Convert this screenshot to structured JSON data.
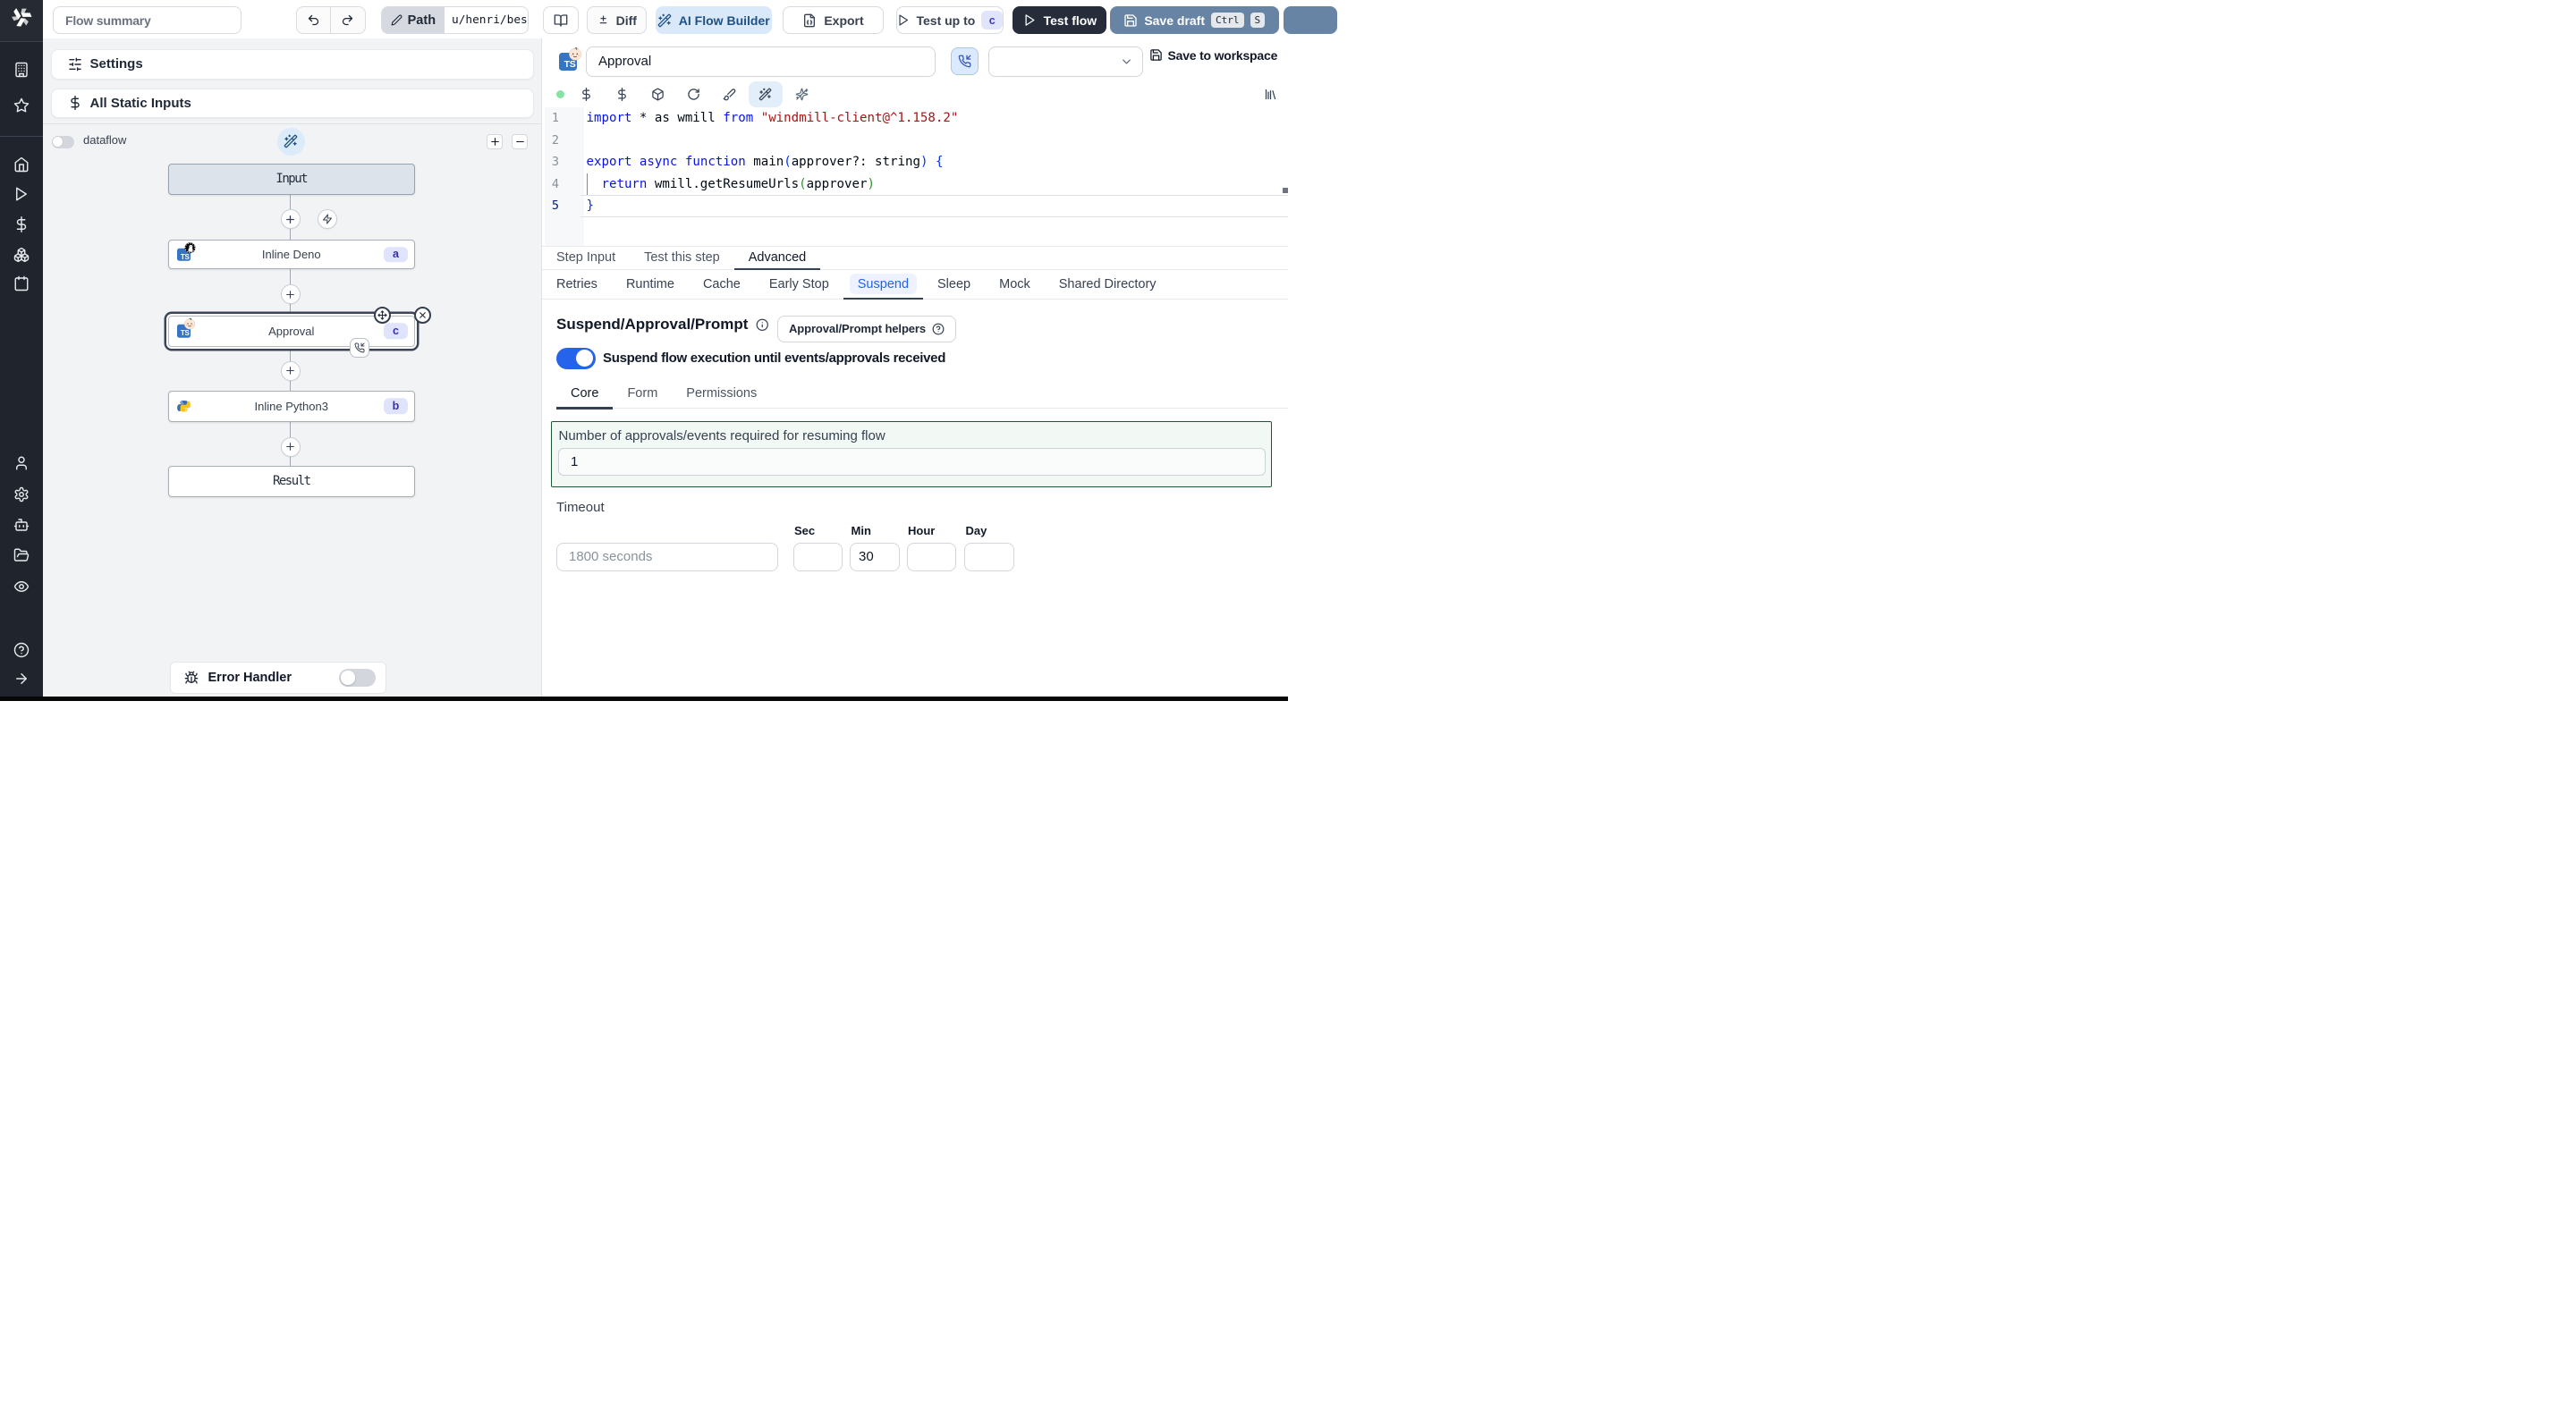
{
  "topbar": {
    "flow_summary_placeholder": "Flow summary",
    "path_label": "Path",
    "path_value": "u/henri/bes",
    "diff_label": "Diff",
    "ai_flow_builder_label": "AI Flow Builder",
    "export_label": "Export",
    "test_up_to_label": "Test up to",
    "test_up_to_step": "c",
    "test_flow_label": "Test flow",
    "save_draft_label": "Save draft",
    "kbd_ctrl": "Ctrl",
    "kbd_s": "S"
  },
  "left_panel": {
    "settings_label": "Settings",
    "static_inputs_label": "All Static Inputs",
    "dataflow_label": "dataflow",
    "nodes": {
      "input": {
        "label": "Input"
      },
      "deno": {
        "label": "Inline Deno",
        "badge": "a"
      },
      "approval": {
        "label": "Approval",
        "badge": "c"
      },
      "python": {
        "label": "Inline Python3",
        "badge": "b"
      },
      "result": {
        "label": "Result"
      }
    },
    "error_handler_label": "Error Handler"
  },
  "step_header": {
    "lang_badge": "TS",
    "name_value": "Approval",
    "save_to_workspace_label": "Save to workspace"
  },
  "editor": {
    "line_numbers": [
      "1",
      "2",
      "3",
      "4",
      "5"
    ],
    "lines": {
      "l1": {
        "s1": "import",
        "s2": " * as wmill ",
        "s3": "from",
        "s4": " ",
        "s5": "\"windmill-client@^1.158.2\""
      },
      "l3": {
        "s1": "export",
        "s2": " ",
        "s3": "async",
        "s4": " ",
        "s5": "function",
        "s6": " main",
        "s7": "(",
        "s8": "approver?: ",
        "s9": "string",
        "s10": ")",
        "s11": " ",
        "s12": "{"
      },
      "l4": {
        "s1": "  ",
        "s2": "return",
        "s3": " wmill.getResumeUrls",
        "s4": "(",
        "s5": "approver",
        "s6": ")"
      },
      "l5": {
        "s1": "}"
      }
    }
  },
  "tabs": {
    "step_input": "Step Input",
    "test_this_step": "Test this step",
    "advanced": "Advanced"
  },
  "subtabs": {
    "retries": "Retries",
    "runtime": "Runtime",
    "cache": "Cache",
    "early_stop": "Early Stop",
    "suspend": "Suspend",
    "sleep": "Sleep",
    "mock": "Mock",
    "shared_directory": "Shared Directory"
  },
  "suspend_section": {
    "title": "Suspend/Approval/Prompt",
    "helpers_button_label": "Approval/Prompt helpers",
    "toggle_label": "Suspend flow execution until events/approvals received",
    "tab_core": "Core",
    "tab_form": "Form",
    "tab_permissions": "Permissions",
    "approvals_label": "Number of approvals/events required for resuming flow",
    "approvals_value": "1",
    "timeout_label": "Timeout",
    "timeout_placeholder": "1800 seconds",
    "sec_label": "Sec",
    "min_label": "Min",
    "hour_label": "Hour",
    "day_label": "Day",
    "min_value": "30"
  },
  "colors": {
    "accent_blue": "#2563eb",
    "toggle_on": "#2563eb",
    "suspend_green_border": "#1d5733",
    "save_draft_bg": "#6884a4",
    "test_flow_bg": "#262c3a"
  }
}
